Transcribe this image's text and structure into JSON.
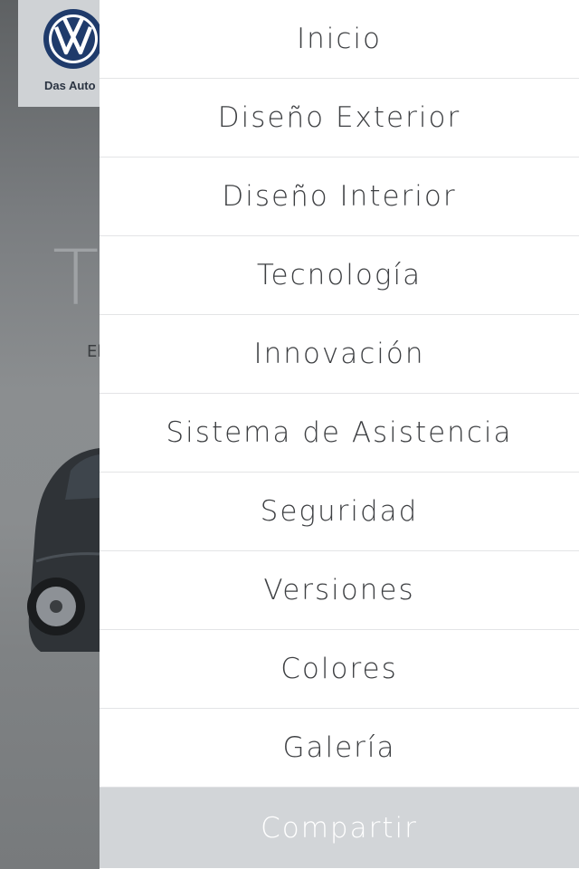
{
  "background": {
    "logo_text": "Das Auto",
    "title_fragment": "T",
    "subtitle_fragment": "El"
  },
  "menu": {
    "items": [
      {
        "label": "Inicio"
      },
      {
        "label": "Diseño Exterior"
      },
      {
        "label": "Diseño Interior"
      },
      {
        "label": "Tecnología"
      },
      {
        "label": "Innovación"
      },
      {
        "label": "Sistema de Asistencia"
      },
      {
        "label": "Seguridad"
      },
      {
        "label": "Versiones"
      },
      {
        "label": "Colores"
      },
      {
        "label": "Galería"
      }
    ],
    "share_label": "Compartir"
  },
  "colors": {
    "drawer_bg": "#ffffff",
    "share_bg": "#d2d5d8",
    "text": "#3d3f42",
    "vw_blue": "#1f3b6b"
  }
}
